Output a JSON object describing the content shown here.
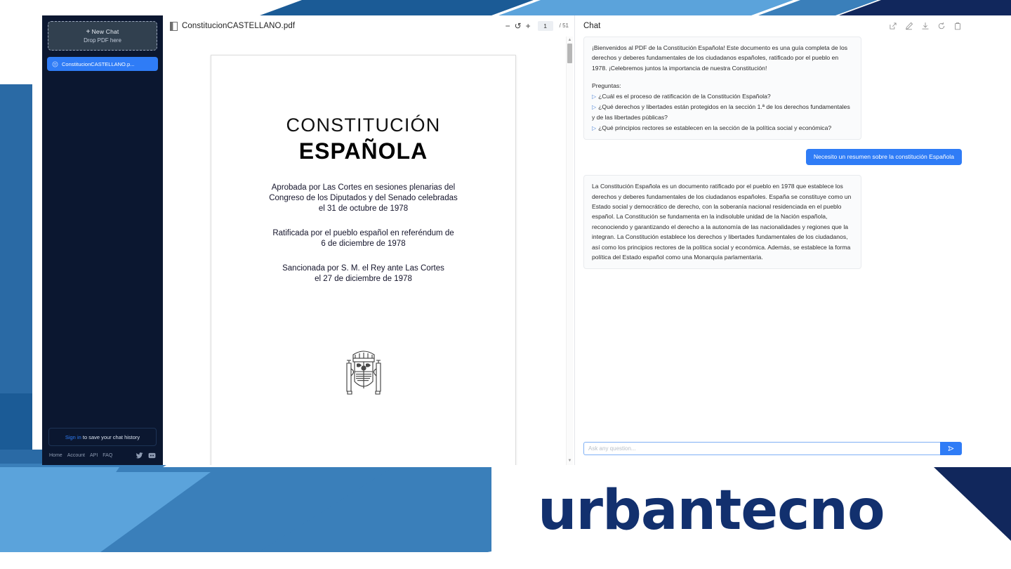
{
  "sidebar": {
    "new_chat": {
      "label": "New Chat",
      "plus": "+",
      "sub_label": "Drop PDF here"
    },
    "chats": [
      {
        "name": "ConstitucionCASTELLANO.p...",
        "icon": "pdf-file-icon",
        "active": true
      }
    ],
    "signin": {
      "link_label": "Sign in",
      "rest_label": " to save your chat history"
    },
    "links": [
      {
        "label": "Home"
      },
      {
        "label": "Account"
      },
      {
        "label": "API"
      },
      {
        "label": "FAQ"
      }
    ],
    "social": [
      {
        "icon": "twitter-icon"
      },
      {
        "icon": "discord-icon"
      }
    ]
  },
  "pdf": {
    "file_name": "ConstitucionCASTELLANO.pdf",
    "zoom_out": "−",
    "rotate": "↺",
    "zoom_in": "+",
    "current_page": "1",
    "total_pages": "/ 51",
    "document": {
      "title_line1": "CONSTITUCIÓN",
      "title_line2": "ESPAÑOLA",
      "block1_line1": "Aprobada por Las Cortes en sesiones plenarias del",
      "block1_line2": "Congreso de los Diputados y del Senado celebradas",
      "block1_line3": "el 31 de octubre de 1978",
      "block2_line1": "Ratificada por el pueblo español en referéndum de",
      "block2_line2": "6 de diciembre de 1978",
      "block3_line1": "Sancionada por S. M. el Rey ante Las Cortes",
      "block3_line2": "el 27 de diciembre de 1978",
      "emblem": "spanish-coat-of-arms"
    }
  },
  "chat": {
    "title": "Chat",
    "actions": [
      {
        "icon": "share-icon"
      },
      {
        "icon": "edit-pencil-icon"
      },
      {
        "icon": "download-icon"
      },
      {
        "icon": "refresh-icon"
      },
      {
        "icon": "trash-icon"
      }
    ],
    "messages": [
      {
        "role": "assistant",
        "intro": "¡Bienvenidos al PDF de la Constitución Española! Este documento es una guía completa de los derechos y deberes fundamentales de los ciudadanos españoles, ratificado por el pueblo en 1978. ¡Celebremos juntos la importancia de nuestra Constitución!",
        "questions_heading": "Preguntas:",
        "questions": [
          "¿Cuál es el proceso de ratificación de la Constitución Española?",
          "¿Qué derechos y libertades están protegidos en la sección 1.ª de los derechos fundamentales y de las libertades públicas?",
          "¿Qué principios rectores se establecen en la sección de la política social y económica?"
        ]
      },
      {
        "role": "user",
        "text": "Necesito un resumen sobre la constitución Española"
      },
      {
        "role": "assistant",
        "text": "La Constitución Española es un documento ratificado por el pueblo en 1978 que establece los derechos y deberes fundamentales de los ciudadanos españoles. España se constituye como un Estado social y democrático de derecho, con la soberanía nacional residenciada en el pueblo español. La Constitución se fundamenta en la indisoluble unidad de la Nación española, reconociendo y garantizando el derecho a la autonomía de las nacionalidades y regiones que la integran. La Constitución establece los derechos y libertades fundamentales de los ciudadanos, así como los principios rectores de la política social y económica. Además, se establece la forma política del Estado español como una Monarquía parlamentaria."
      }
    ],
    "input": {
      "value": "",
      "placeholder": "Ask any question...",
      "send_icon": "send-arrow-icon"
    }
  },
  "branding": {
    "logo_text": "urbantecno"
  },
  "colors": {
    "accent_blue": "#2f7cf6",
    "sidebar_bg": "#0b1730",
    "brand_navy": "#12306e",
    "deco_light_blue": "#5ba3db",
    "deco_mid_blue": "#3a7fba",
    "deco_dark_blue": "#1b3a6b",
    "deco_navy": "#11275c"
  }
}
